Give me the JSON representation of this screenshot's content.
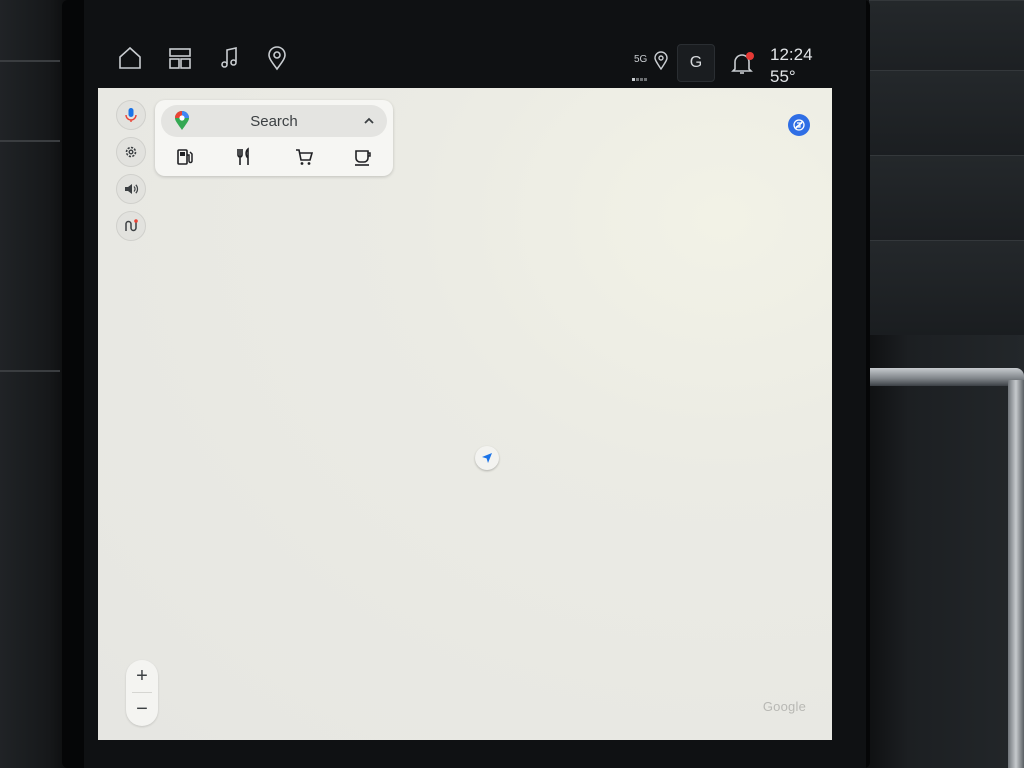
{
  "status_bar": {
    "network": "5G",
    "profile_initial": "G",
    "time": "12:24",
    "temperature": "55°"
  },
  "nav_icons": [
    "home-icon",
    "dashboard-icon",
    "music-icon",
    "location-icon"
  ],
  "search": {
    "label": "Search",
    "categories": [
      "gas-station-icon",
      "restaurant-icon",
      "grocery-cart-icon",
      "coffee-icon"
    ]
  },
  "side_controls": [
    "microphone-icon",
    "settings-icon",
    "volume-icon",
    "route-icon"
  ],
  "zoom": {
    "in_label": "+",
    "out_label": "−"
  },
  "map": {
    "attribution": "Google"
  },
  "colors": {
    "accent": "#2f6ee5",
    "map_background": "#e6e6e2",
    "alert_dot": "#e53935"
  }
}
